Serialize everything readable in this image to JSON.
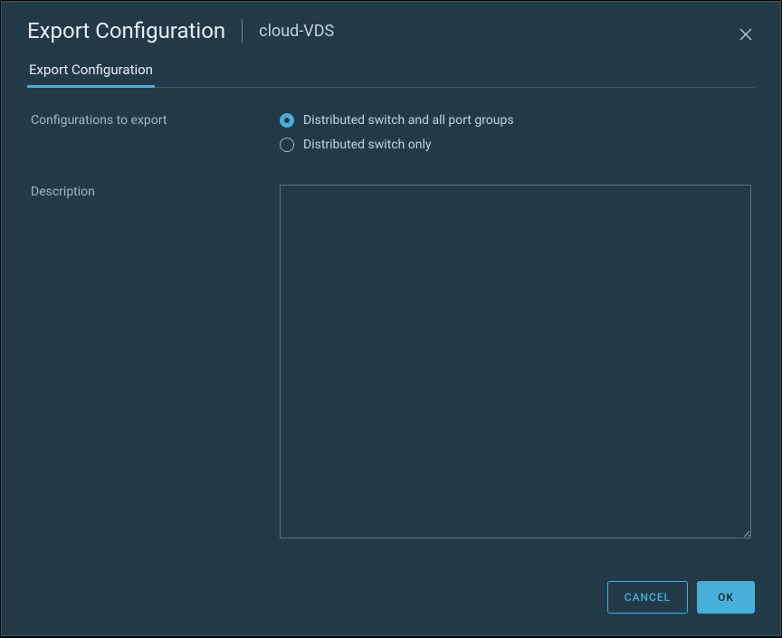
{
  "dialog": {
    "title": "Export Configuration",
    "subtitle": "cloud-VDS"
  },
  "tabs": {
    "export_config": "Export Configuration"
  },
  "form": {
    "configs_label": "Configurations to export",
    "radio_all": "Distributed switch and all port groups",
    "radio_switch_only": "Distributed switch only",
    "description_label": "Description",
    "description_value": ""
  },
  "footer": {
    "cancel": "CANCEL",
    "ok": "OK"
  }
}
